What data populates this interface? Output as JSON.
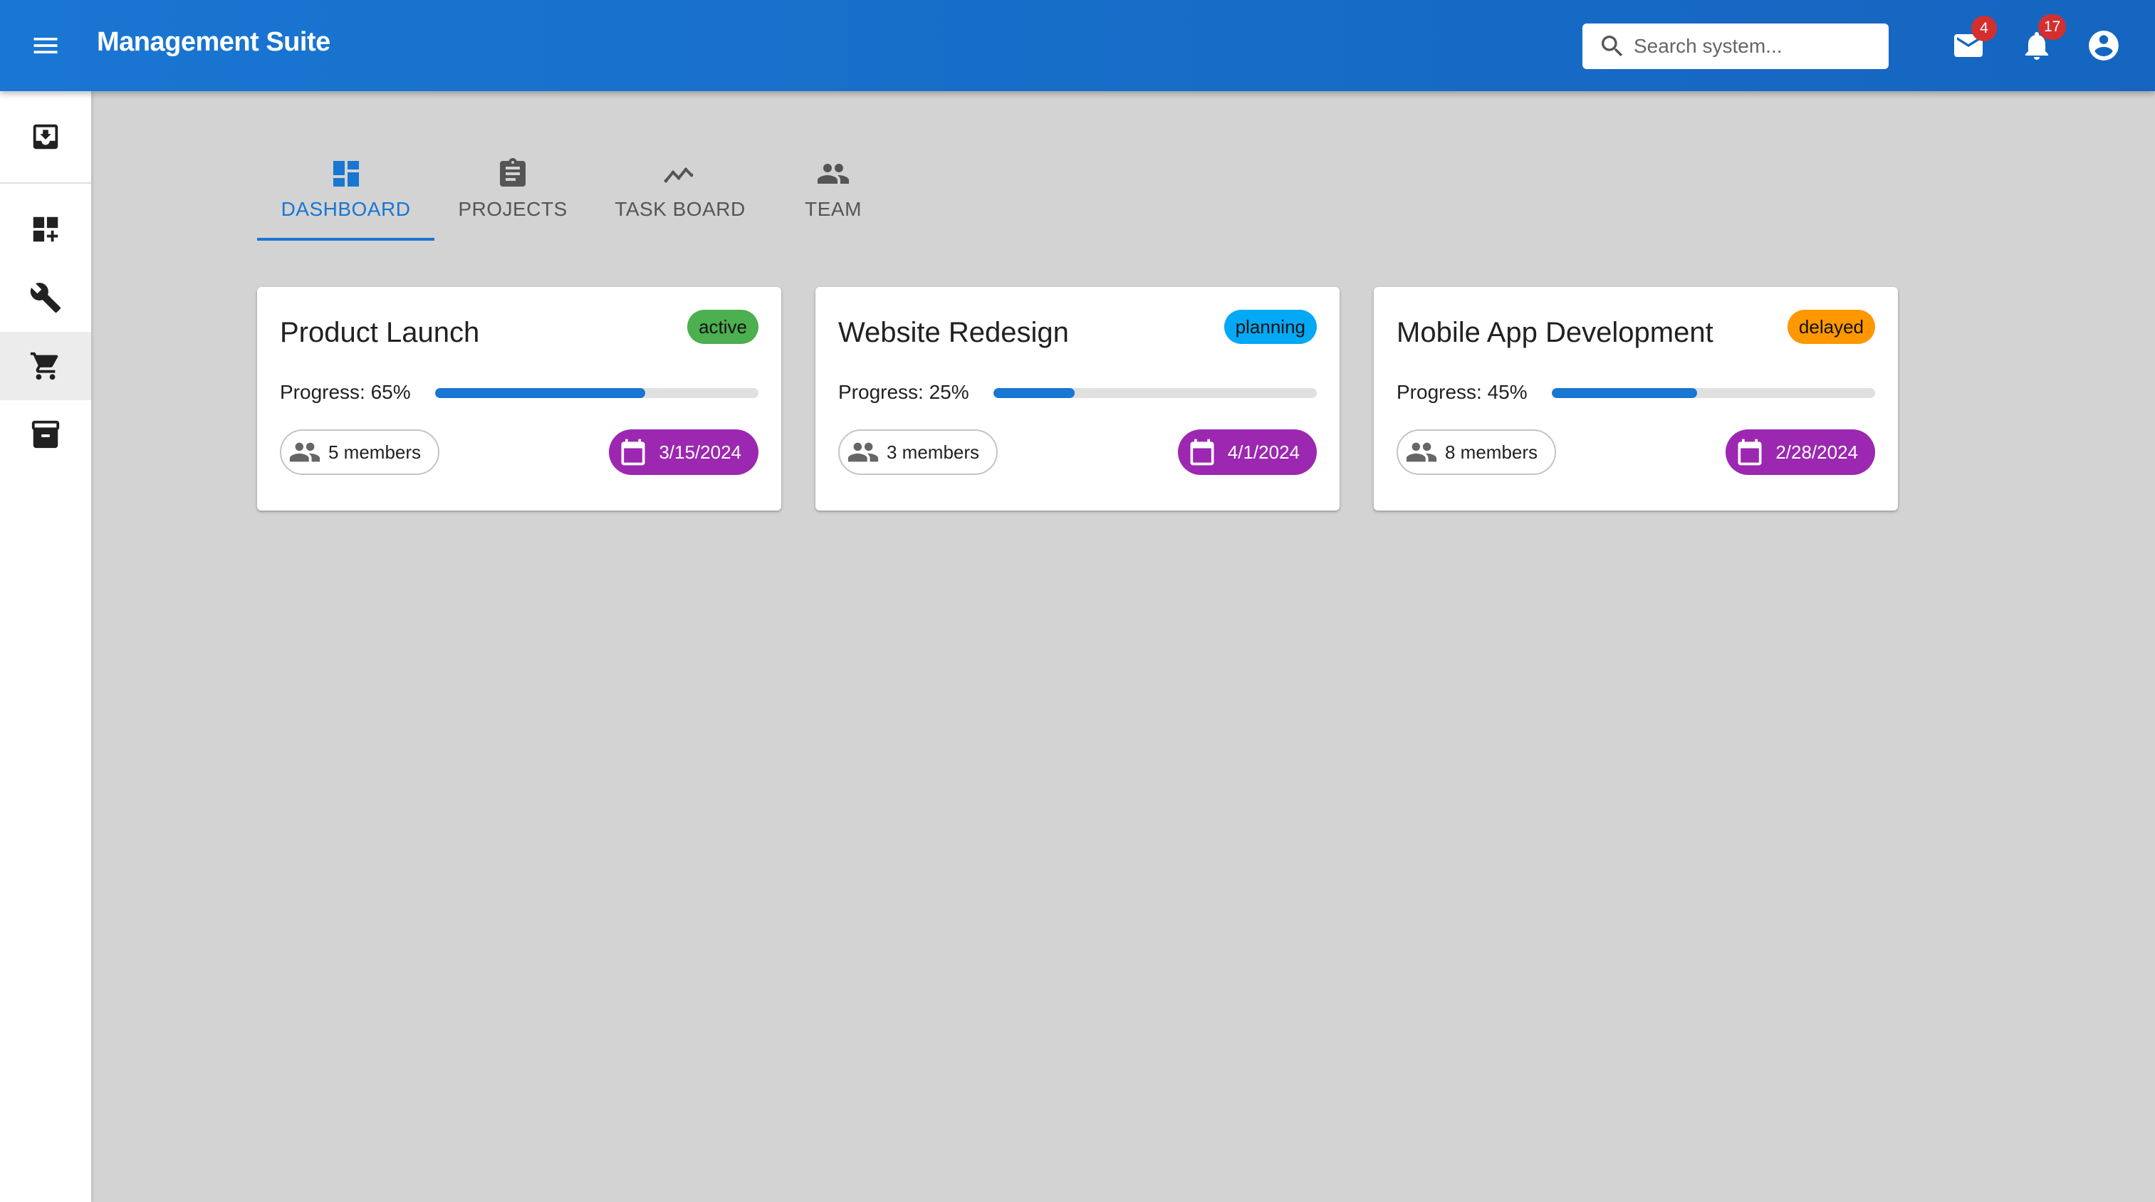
{
  "app": {
    "title": "Management Suite"
  },
  "search": {
    "placeholder": "Search system..."
  },
  "header": {
    "mail_badge": "4",
    "notifications_badge": "17"
  },
  "sidebar": {
    "items": [
      {
        "icon": "inbox-download-icon"
      },
      {
        "icon": "dashboard-add-icon"
      },
      {
        "icon": "wrench-icon"
      },
      {
        "icon": "cart-icon",
        "selected": true
      },
      {
        "icon": "archive-icon"
      }
    ]
  },
  "tabs": [
    {
      "label": "DASHBOARD",
      "icon": "dashboard-icon",
      "active": true
    },
    {
      "label": "PROJECTS",
      "icon": "clipboard-icon"
    },
    {
      "label": "TASK BOARD",
      "icon": "trend-icon"
    },
    {
      "label": "TEAM",
      "icon": "people-icon"
    }
  ],
  "projects": [
    {
      "title": "Product Launch",
      "status": "active",
      "status_color": "#4caf50",
      "progress_label": "Progress: 65%",
      "progress": 0.65,
      "members": "5 members",
      "date": "3/15/2024"
    },
    {
      "title": "Website Redesign",
      "status": "planning",
      "status_color": "#03a9f4",
      "progress_label": "Progress: 25%",
      "progress": 0.25,
      "members": "3 members",
      "date": "4/1/2024"
    },
    {
      "title": "Mobile App Development",
      "status": "delayed",
      "status_color": "#ff9800",
      "progress_label": "Progress: 45%",
      "progress": 0.45,
      "members": "8 members",
      "date": "2/28/2024"
    }
  ],
  "colors": {
    "primary": "#1976d2",
    "date_chip": "#9c27b0",
    "badge": "#d32f2f"
  }
}
